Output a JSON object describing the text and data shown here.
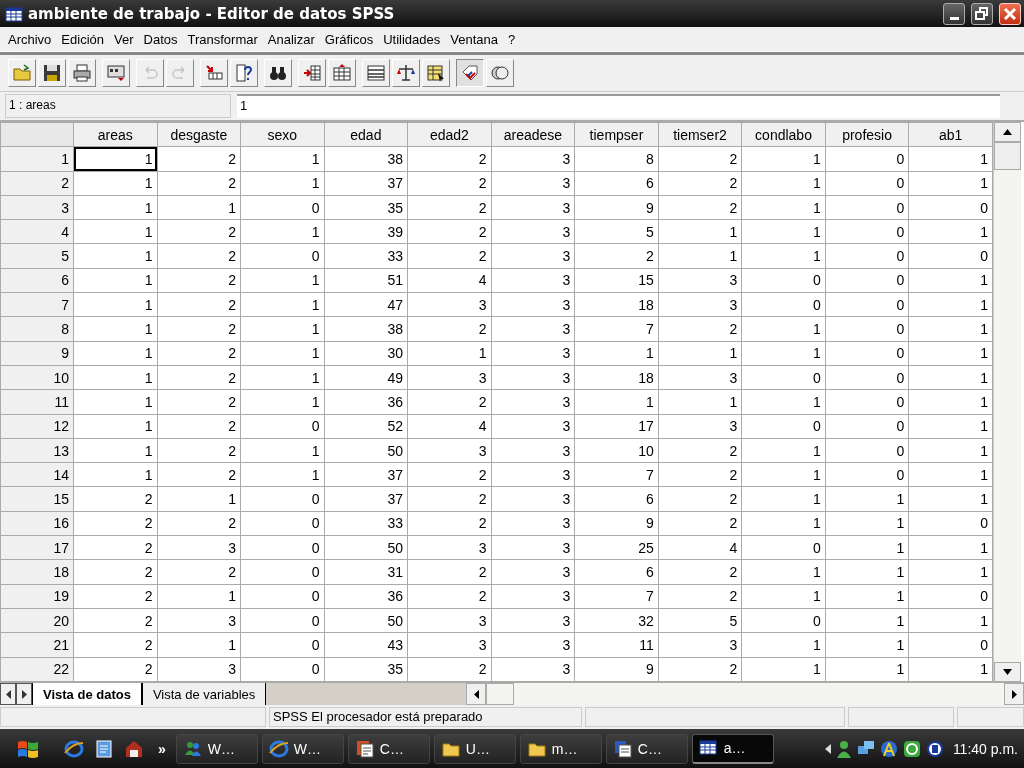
{
  "window": {
    "title": "ambiente de trabajo - Editor de datos SPSS"
  },
  "menu": [
    "Archivo",
    "Edición",
    "Ver",
    "Datos",
    "Transformar",
    "Analizar",
    "Gráficos",
    "Utilidades",
    "Ventana",
    "?"
  ],
  "toolbar": [
    [
      {
        "disabled": false,
        "pressed": false
      },
      {
        "disabled": false,
        "pressed": false
      },
      {
        "disabled": false,
        "pressed": false
      }
    ],
    [
      {
        "disabled": false,
        "pressed": false
      }
    ],
    [
      {
        "disabled": true,
        "pressed": false
      },
      {
        "disabled": true,
        "pressed": false
      }
    ],
    [
      {
        "disabled": false,
        "pressed": false
      },
      {
        "disabled": false,
        "pressed": false
      }
    ],
    [
      {
        "disabled": false,
        "pressed": false
      }
    ],
    [
      {
        "disabled": false,
        "pressed": false
      },
      {
        "disabled": false,
        "pressed": false
      }
    ],
    [
      {
        "disabled": false,
        "pressed": false
      },
      {
        "disabled": false,
        "pressed": false
      },
      {
        "disabled": false,
        "pressed": false
      }
    ],
    [
      {
        "disabled": false,
        "pressed": true
      },
      {
        "disabled": false,
        "pressed": false
      }
    ]
  ],
  "cell_editor": {
    "reference": "1 : areas",
    "value": "1"
  },
  "table": {
    "columns": [
      "areas",
      "desgaste",
      "sexo",
      "edad",
      "edad2",
      "areadese",
      "tiempser",
      "tiemser2",
      "condlabo",
      "profesio",
      "ab1"
    ],
    "rows": [
      {
        "label": "1",
        "cells": [
          "1",
          "2",
          "1",
          "38",
          "2",
          "3",
          "8",
          "2",
          "1",
          "0",
          "1"
        ],
        "selected_cell": true
      },
      {
        "label": "2",
        "cells": [
          "1",
          "2",
          "1",
          "37",
          "2",
          "3",
          "6",
          "2",
          "1",
          "0",
          "1"
        ],
        "selected_cell": false
      },
      {
        "label": "3",
        "cells": [
          "1",
          "1",
          "0",
          "35",
          "2",
          "3",
          "9",
          "2",
          "1",
          "0",
          "0"
        ],
        "selected_cell": false
      },
      {
        "label": "4",
        "cells": [
          "1",
          "2",
          "1",
          "39",
          "2",
          "3",
          "5",
          "1",
          "1",
          "0",
          "1"
        ],
        "selected_cell": false
      },
      {
        "label": "5",
        "cells": [
          "1",
          "2",
          "0",
          "33",
          "2",
          "3",
          "2",
          "1",
          "1",
          "0",
          "0"
        ],
        "selected_cell": false
      },
      {
        "label": "6",
        "cells": [
          "1",
          "2",
          "1",
          "51",
          "4",
          "3",
          "15",
          "3",
          "0",
          "0",
          "1"
        ],
        "selected_cell": false
      },
      {
        "label": "7",
        "cells": [
          "1",
          "2",
          "1",
          "47",
          "3",
          "3",
          "18",
          "3",
          "0",
          "0",
          "1"
        ],
        "selected_cell": false
      },
      {
        "label": "8",
        "cells": [
          "1",
          "2",
          "1",
          "38",
          "2",
          "3",
          "7",
          "2",
          "1",
          "0",
          "1"
        ],
        "selected_cell": false
      },
      {
        "label": "9",
        "cells": [
          "1",
          "2",
          "1",
          "30",
          "1",
          "3",
          "1",
          "1",
          "1",
          "0",
          "1"
        ],
        "selected_cell": false
      },
      {
        "label": "10",
        "cells": [
          "1",
          "2",
          "1",
          "49",
          "3",
          "3",
          "18",
          "3",
          "0",
          "0",
          "1"
        ],
        "selected_cell": false
      },
      {
        "label": "11",
        "cells": [
          "1",
          "2",
          "1",
          "36",
          "2",
          "3",
          "1",
          "1",
          "1",
          "0",
          "1"
        ],
        "selected_cell": false
      },
      {
        "label": "12",
        "cells": [
          "1",
          "2",
          "0",
          "52",
          "4",
          "3",
          "17",
          "3",
          "0",
          "0",
          "1"
        ],
        "selected_cell": false
      },
      {
        "label": "13",
        "cells": [
          "1",
          "2",
          "1",
          "50",
          "3",
          "3",
          "10",
          "2",
          "1",
          "0",
          "1"
        ],
        "selected_cell": false
      },
      {
        "label": "14",
        "cells": [
          "1",
          "2",
          "1",
          "37",
          "2",
          "3",
          "7",
          "2",
          "1",
          "0",
          "1"
        ],
        "selected_cell": false
      },
      {
        "label": "15",
        "cells": [
          "2",
          "1",
          "0",
          "37",
          "2",
          "3",
          "6",
          "2",
          "1",
          "1",
          "1"
        ],
        "selected_cell": false
      },
      {
        "label": "16",
        "cells": [
          "2",
          "2",
          "0",
          "33",
          "2",
          "3",
          "9",
          "2",
          "1",
          "1",
          "0"
        ],
        "selected_cell": false
      },
      {
        "label": "17",
        "cells": [
          "2",
          "3",
          "0",
          "50",
          "3",
          "3",
          "25",
          "4",
          "0",
          "1",
          "1"
        ],
        "selected_cell": false
      },
      {
        "label": "18",
        "cells": [
          "2",
          "2",
          "0",
          "31",
          "2",
          "3",
          "6",
          "2",
          "1",
          "1",
          "1"
        ],
        "selected_cell": false
      },
      {
        "label": "19",
        "cells": [
          "2",
          "1",
          "0",
          "36",
          "2",
          "3",
          "7",
          "2",
          "1",
          "1",
          "0"
        ],
        "selected_cell": false
      },
      {
        "label": "20",
        "cells": [
          "2",
          "3",
          "0",
          "50",
          "3",
          "3",
          "32",
          "5",
          "0",
          "1",
          "1"
        ],
        "selected_cell": false
      },
      {
        "label": "21",
        "cells": [
          "2",
          "1",
          "0",
          "43",
          "3",
          "3",
          "11",
          "3",
          "1",
          "1",
          "0"
        ],
        "selected_cell": false
      },
      {
        "label": "22",
        "cells": [
          "2",
          "3",
          "0",
          "35",
          "2",
          "3",
          "9",
          "2",
          "1",
          "1",
          "1"
        ],
        "selected_cell": false
      }
    ]
  },
  "sheet_tabs": [
    {
      "label": "Vista de datos",
      "selected": true
    },
    {
      "label": "Vista de variables",
      "selected": false
    }
  ],
  "status_bar": {
    "message": "SPSS El procesador  está preparado"
  },
  "taskbar": {
    "chevron": "»",
    "tasks": [
      {
        "label": "W…",
        "selected": false
      },
      {
        "label": "W…",
        "selected": false
      },
      {
        "label": "C…",
        "selected": false
      },
      {
        "label": "U…",
        "selected": false
      },
      {
        "label": "m…",
        "selected": false
      },
      {
        "label": "C…",
        "selected": false
      },
      {
        "label": "a…",
        "selected": true
      }
    ],
    "clock": "11:40 p.m."
  }
}
